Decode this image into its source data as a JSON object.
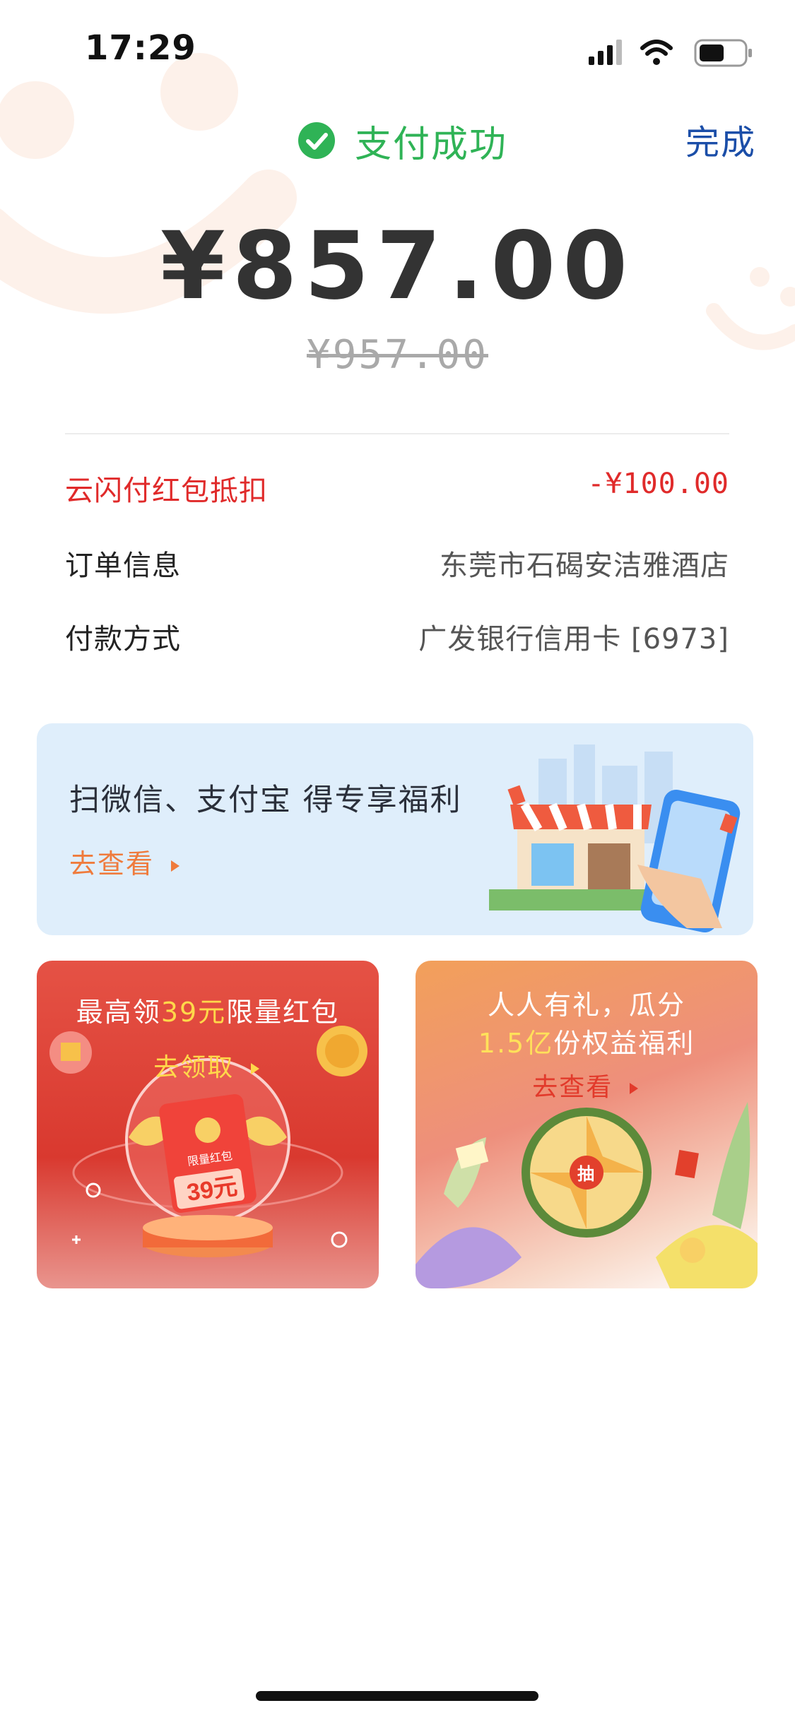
{
  "status_bar": {
    "time": "17:29"
  },
  "header": {
    "status_text": "支付成功",
    "done_label": "完成"
  },
  "payment": {
    "amount": "¥857.00",
    "original_amount": "¥957.00"
  },
  "details": [
    {
      "label": "云闪付红包抵扣",
      "value": "-¥100.00"
    },
    {
      "label": "订单信息",
      "value": "东莞市石碣安洁雅酒店"
    },
    {
      "label": "付款方式",
      "value": "广发银行信用卡 [6973]"
    }
  ],
  "banner": {
    "title": "扫微信、支付宝 得专享福利",
    "link": "去查看"
  },
  "cards": {
    "left": {
      "title_prefix": "最高领",
      "title_highlight": "39元",
      "title_suffix": "限量红包",
      "link": "去领取",
      "packet_label": "限量红包",
      "packet_amount": "39元"
    },
    "right": {
      "title_line1": "人人有礼，瓜分",
      "title_highlight": "1.5亿",
      "title_suffix": "份权益福利",
      "link": "去查看",
      "wheel_center": "抽"
    }
  },
  "colors": {
    "success": "#2fb356",
    "done": "#1b4ea8",
    "discount": "#e02a2a",
    "link_orange": "#ef7b3c",
    "banner_bg": "#dfeefb"
  },
  "icons": [
    "signal-icon",
    "wifi-icon",
    "battery-icon",
    "check-circle-icon",
    "play-arrow-icon"
  ]
}
